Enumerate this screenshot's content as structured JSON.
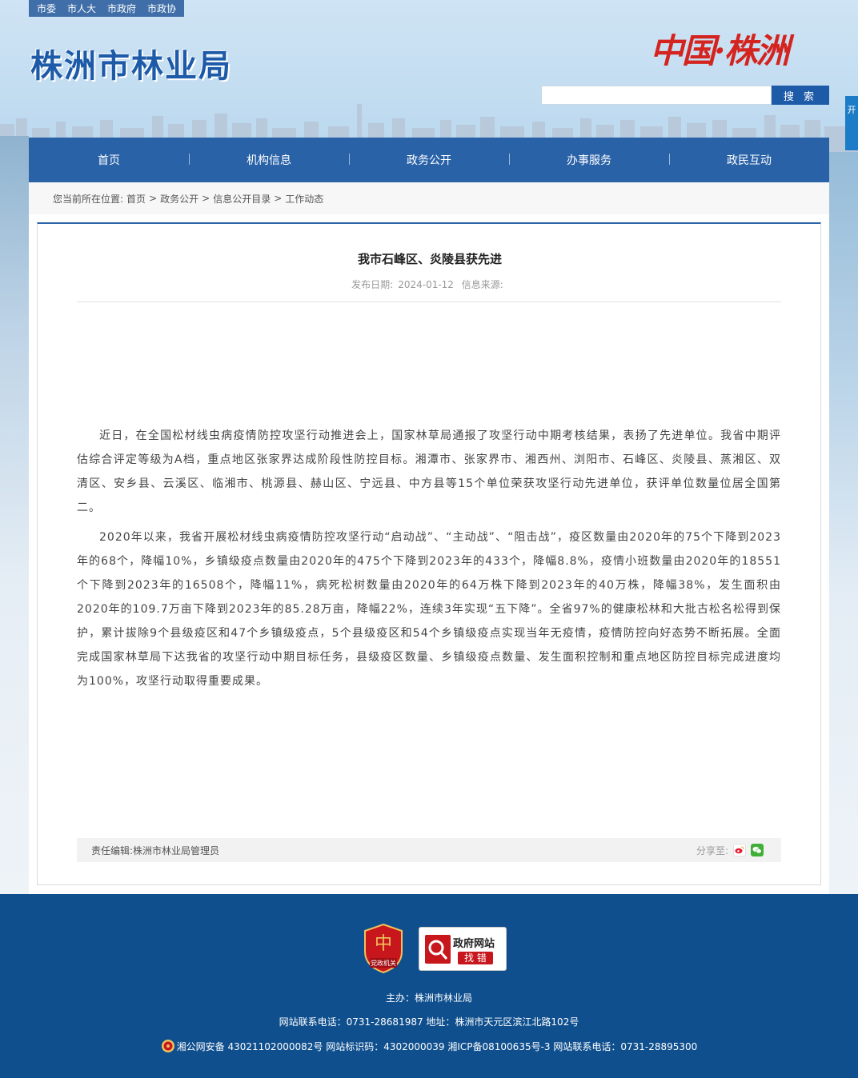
{
  "top_links": [
    "市委",
    "市人大",
    "市政府",
    "市政协"
  ],
  "site_title": "株洲市林业局",
  "brand_calligraphy": "中国·株洲",
  "search": {
    "placeholder": "",
    "button_label": "搜 索"
  },
  "side_tab": "开",
  "nav": [
    "首页",
    "机构信息",
    "政务公开",
    "办事服务",
    "政民互动"
  ],
  "breadcrumb": {
    "prefix": "您当前所在位置:",
    "items": [
      "首页",
      "政务公开",
      "信息公开目录",
      "工作动态"
    ],
    "separator": ">"
  },
  "article": {
    "title": "我市石峰区、炎陵县获先进",
    "date_label": "发布日期:",
    "date": "2024-01-12",
    "source_label": "信息来源:",
    "source": "",
    "paragraphs": [
      "近日，在全国松材线虫病疫情防控攻坚行动推进会上，国家林草局通报了攻坚行动中期考核结果，表扬了先进单位。我省中期评估综合评定等级为A档，重点地区张家界达成阶段性防控目标。湘潭市、张家界市、湘西州、浏阳市、石峰区、炎陵县、蒸湘区、双清区、安乡县、云溪区、临湘市、桃源县、赫山区、宁远县、中方县等15个单位荣获攻坚行动先进单位，获评单位数量位居全国第二。",
      "2020年以来，我省开展松材线虫病疫情防控攻坚行动“启动战”、“主动战”、“阻击战”，疫区数量由2020年的75个下降到2023年的68个，降幅10%，乡镇级疫点数量由2020年的475个下降到2023年的433个，降幅8.8%，疫情小班数量由2020年的18551个下降到2023年的16508个，降幅11%，病死松树数量由2020年的64万株下降到2023年的40万株，降幅38%，发生面积由2020年的109.7万亩下降到2023年的85.28万亩，降幅22%，连续3年实现“五下降”。全省97%的健康松林和大批古松名松得到保护，累计拔除9个县级疫区和47个乡镇级疫点，5个县级疫区和54个乡镇级疫点实现当年无疫情，疫情防控向好态势不断拓展。全面完成国家林草局下达我省的攻坚行动中期目标任务，县级疫区数量、乡镇级疫点数量、发生面积控制和重点地区防控目标完成进度均为100%，攻坚行动取得重要成果。"
    ],
    "editor_label": "责任编辑:",
    "editor": "株洲市林业局管理员",
    "share_label": "分享至:"
  },
  "footer": {
    "party_badge": "党政机关",
    "gov_badge_title": "政府网站",
    "gov_badge_sub": "找 错",
    "sponsor": "主办：株洲市林业局",
    "contact": "网站联系电话：0731-28681987 地址：株洲市天元区滨江北路102号",
    "record": "湘公网安备 43021102000082号 网站标识码：4302000039 湘ICP备08100635号-3 网站联系电话：0731-28895300"
  },
  "colors": {
    "brand_blue": "#2a62a8",
    "footer_blue": "#0f4f8e",
    "calligraphy_red": "#d4241f"
  }
}
